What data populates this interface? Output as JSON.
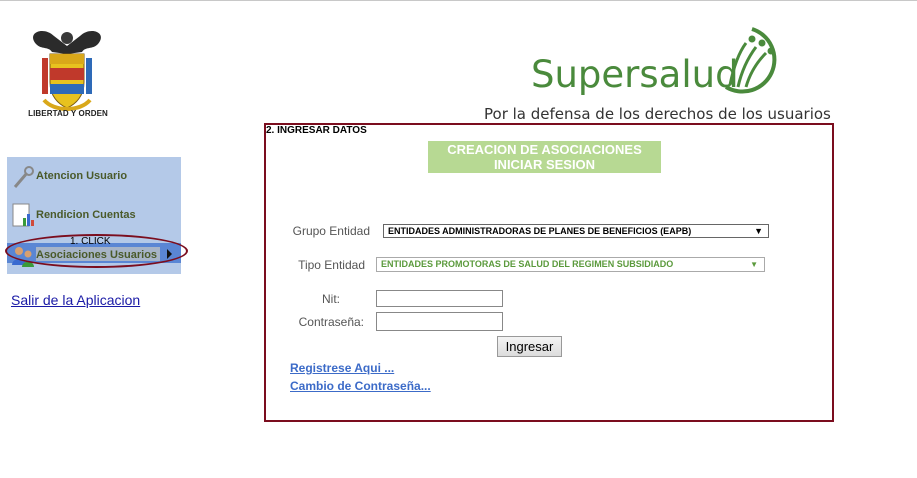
{
  "header": {
    "coat_caption": "LIBERTAD Y ORDEN",
    "brand": "Supersalud",
    "tagline": "Por la defensa de los derechos de los usuarios",
    "brand_color": "#4a8a3c"
  },
  "sidebar": {
    "items": [
      {
        "label": "Atencion Usuario",
        "icon": "wrench-icon"
      },
      {
        "label": "Rendicion Cuentas",
        "icon": "report-chart-icon"
      },
      {
        "label": "Asociaciones Usuarios",
        "icon": "users-group-icon"
      }
    ],
    "annotation": "1. CLICK",
    "exit_link": "Salir de la Aplicacion"
  },
  "form": {
    "annotation": "2. INGRESAR DATOS",
    "title_line1": "CREACION DE ASOCIACIONES",
    "title_line2": "INICIAR SESION",
    "grupo_label": "Grupo Entidad",
    "grupo_value": "ENTIDADES ADMINISTRADORAS DE PLANES DE BENEFICIOS (EAPB)",
    "tipo_label": "Tipo Entidad",
    "tipo_value": "ENTIDADES PROMOTORAS DE SALUD DEL REGIMEN SUBSIDIADO",
    "nit_label": "Nit:",
    "nit_value": "",
    "password_label": "Contraseña:",
    "password_value": "",
    "submit_label": "Ingresar",
    "register_link": "Registrese Aqui ...",
    "change_password_link": "Cambio de Contraseña..."
  },
  "colors": {
    "panel_border": "#7b0d1e",
    "title_bg": "#b7d993",
    "sidebar_bg": "#b4c9e8",
    "link": "#3c6bc8"
  }
}
